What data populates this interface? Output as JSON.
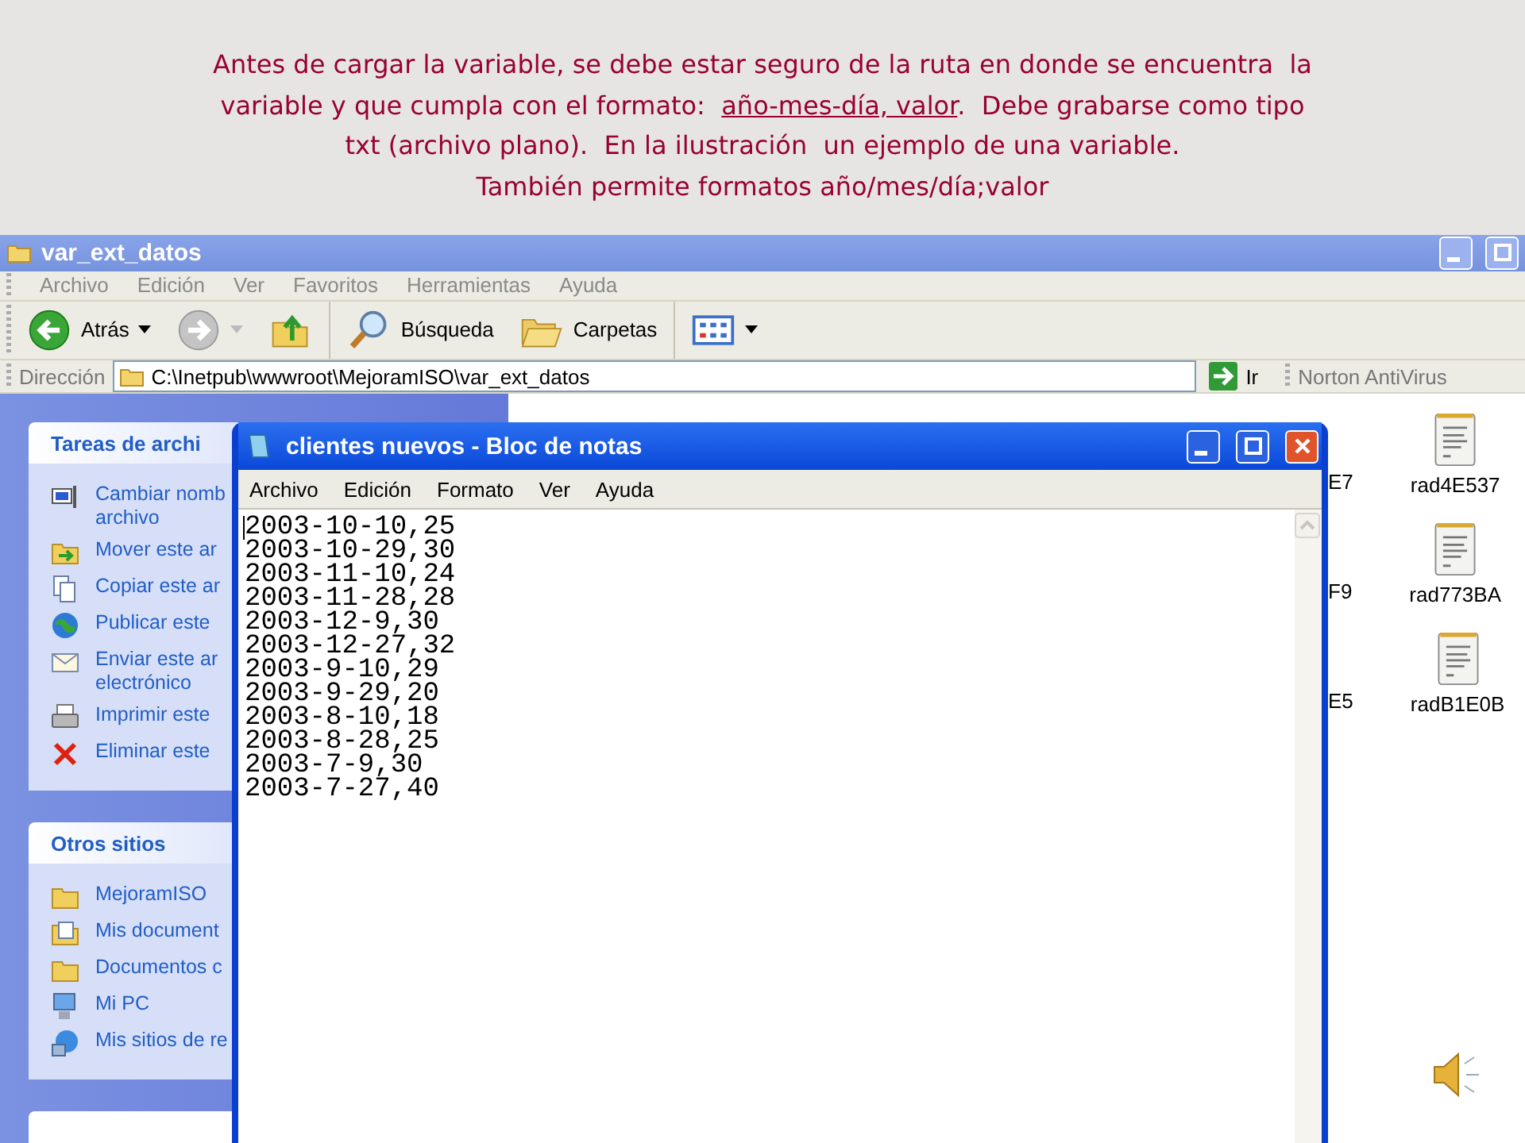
{
  "caption": {
    "lines": [
      {
        "segments": [
          {
            "text": "Antes de cargar la variable, se debe estar seguro de la ruta en donde se encuentra  la",
            "underlined": false
          }
        ]
      },
      {
        "segments": [
          {
            "text": "variable y que cumpla con el formato:  ",
            "underlined": false
          },
          {
            "text": "año-mes-día, valor",
            "underlined": true
          },
          {
            "text": ".  Debe grabarse como tipo",
            "underlined": false
          }
        ]
      },
      {
        "segments": [
          {
            "text": "txt (archivo plano).  En la ilustración  un ejemplo de una variable.",
            "underlined": false
          }
        ]
      },
      {
        "segments": [
          {
            "text": "También permite formatos año/mes/día;valor",
            "underlined": false
          }
        ]
      }
    ]
  },
  "explorer": {
    "title": "var_ext_datos",
    "menu": [
      "Archivo",
      "Edición",
      "Ver",
      "Favoritos",
      "Herramientas",
      "Ayuda"
    ],
    "toolbar": [
      {
        "kind": "back",
        "label": "Atrás"
      },
      {
        "kind": "forward"
      },
      {
        "kind": "up"
      },
      {
        "kind": "search",
        "label": "Búsqueda"
      },
      {
        "kind": "folders",
        "label": "Carpetas"
      },
      {
        "kind": "views"
      }
    ],
    "address": {
      "label": "Dirección",
      "value": "C:\\Inetpub\\wwwroot\\MejoramISO\\var_ext_datos",
      "go": "Ir"
    },
    "links": "Norton AntiVirus",
    "panels": [
      {
        "title": "Tareas de archi",
        "items": [
          {
            "kind": "rename",
            "lines": [
              "Cambiar nomb",
              "archivo"
            ]
          },
          {
            "kind": "move",
            "lines": [
              "Mover este ar"
            ]
          },
          {
            "kind": "copy",
            "lines": [
              "Copiar este ar"
            ]
          },
          {
            "kind": "publish",
            "lines": [
              "Publicar este"
            ]
          },
          {
            "kind": "email",
            "lines": [
              "Enviar este ar",
              "electrónico"
            ]
          },
          {
            "kind": "print",
            "lines": [
              "Imprimir este"
            ]
          },
          {
            "kind": "delete",
            "lines": [
              "Eliminar este"
            ]
          }
        ]
      },
      {
        "title": "Otros sitios",
        "items": [
          {
            "kind": "folder",
            "lines": [
              "MejoramISO"
            ]
          },
          {
            "kind": "documents",
            "lines": [
              "Mis document"
            ]
          },
          {
            "kind": "folder",
            "lines": [
              "Documentos c"
            ]
          },
          {
            "kind": "computer",
            "lines": [
              "Mi PC"
            ]
          },
          {
            "kind": "network",
            "lines": [
              "Mis sitios de re"
            ]
          }
        ]
      }
    ],
    "file_rows": [
      {
        "cut_name": "E7",
        "name": "rad4E537"
      },
      {
        "cut_name": "F9",
        "name": "rad773BA"
      },
      {
        "cut_name": "E5",
        "name": "radB1E0B"
      }
    ]
  },
  "notepad": {
    "title": "clientes nuevos - Bloc de notas",
    "menu": [
      "Archivo",
      "Edición",
      "Formato",
      "Ver",
      "Ayuda"
    ],
    "lines": [
      "2003-10-10,25",
      "2003-10-29,30",
      "2003-11-10,24",
      "2003-11-28,28",
      "2003-12-9,30",
      "2003-12-27,32",
      "2003-9-10,29",
      "2003-9-29,20",
      "2003-8-10,18",
      "2003-8-28,25",
      "2003-7-9,30",
      "2003-7-27,40"
    ]
  }
}
